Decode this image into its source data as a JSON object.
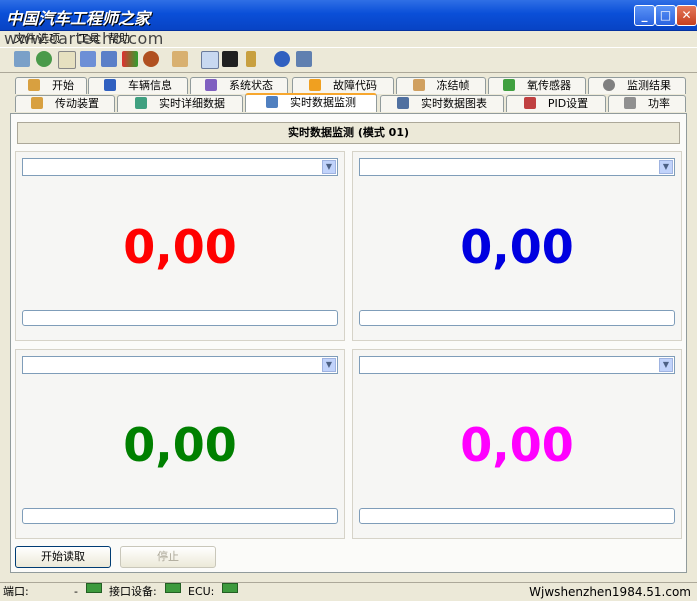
{
  "window": {
    "title": "中国汽车工程师之家",
    "watermark": "www.cartecho.com"
  },
  "menu": [
    "文件",
    "选项",
    "工具",
    "帮助"
  ],
  "toolbar_icons": [
    "wrench-icon",
    "globe-icon",
    "doc-icon",
    "table-icon",
    "chart-icon",
    "flag-icon",
    "person-icon",
    "clipboard-icon",
    "chat-icon",
    "terminal-icon",
    "battery-icon",
    "info-icon",
    "exit-icon"
  ],
  "tabs_row1": [
    "开始",
    "车辆信息",
    "系统状态",
    "故障代码",
    "冻结帧",
    "氧传感器",
    "监测结果"
  ],
  "tabs_row2": [
    "传动装置",
    "实时详细数据",
    "实时数据监测",
    "实时数据图表",
    "PID设置",
    "功率"
  ],
  "active_tab": "实时数据监测",
  "panel": {
    "header": "实时数据监测 (模式 01)"
  },
  "gauges": [
    {
      "value": "0,00",
      "color": "#ff0000"
    },
    {
      "value": "0,00",
      "color": "#0000e0"
    },
    {
      "value": "0,00",
      "color": "#008000"
    },
    {
      "value": "0,00",
      "color": "#ff00ff"
    }
  ],
  "buttons": {
    "start": "开始读取",
    "stop": "停止"
  },
  "status": {
    "port_label": "端口:",
    "port_value": "-",
    "device_label": "接口设备:",
    "ecu_label": "ECU:",
    "footer_text": "Wjwshenzhen1984.51.com"
  }
}
